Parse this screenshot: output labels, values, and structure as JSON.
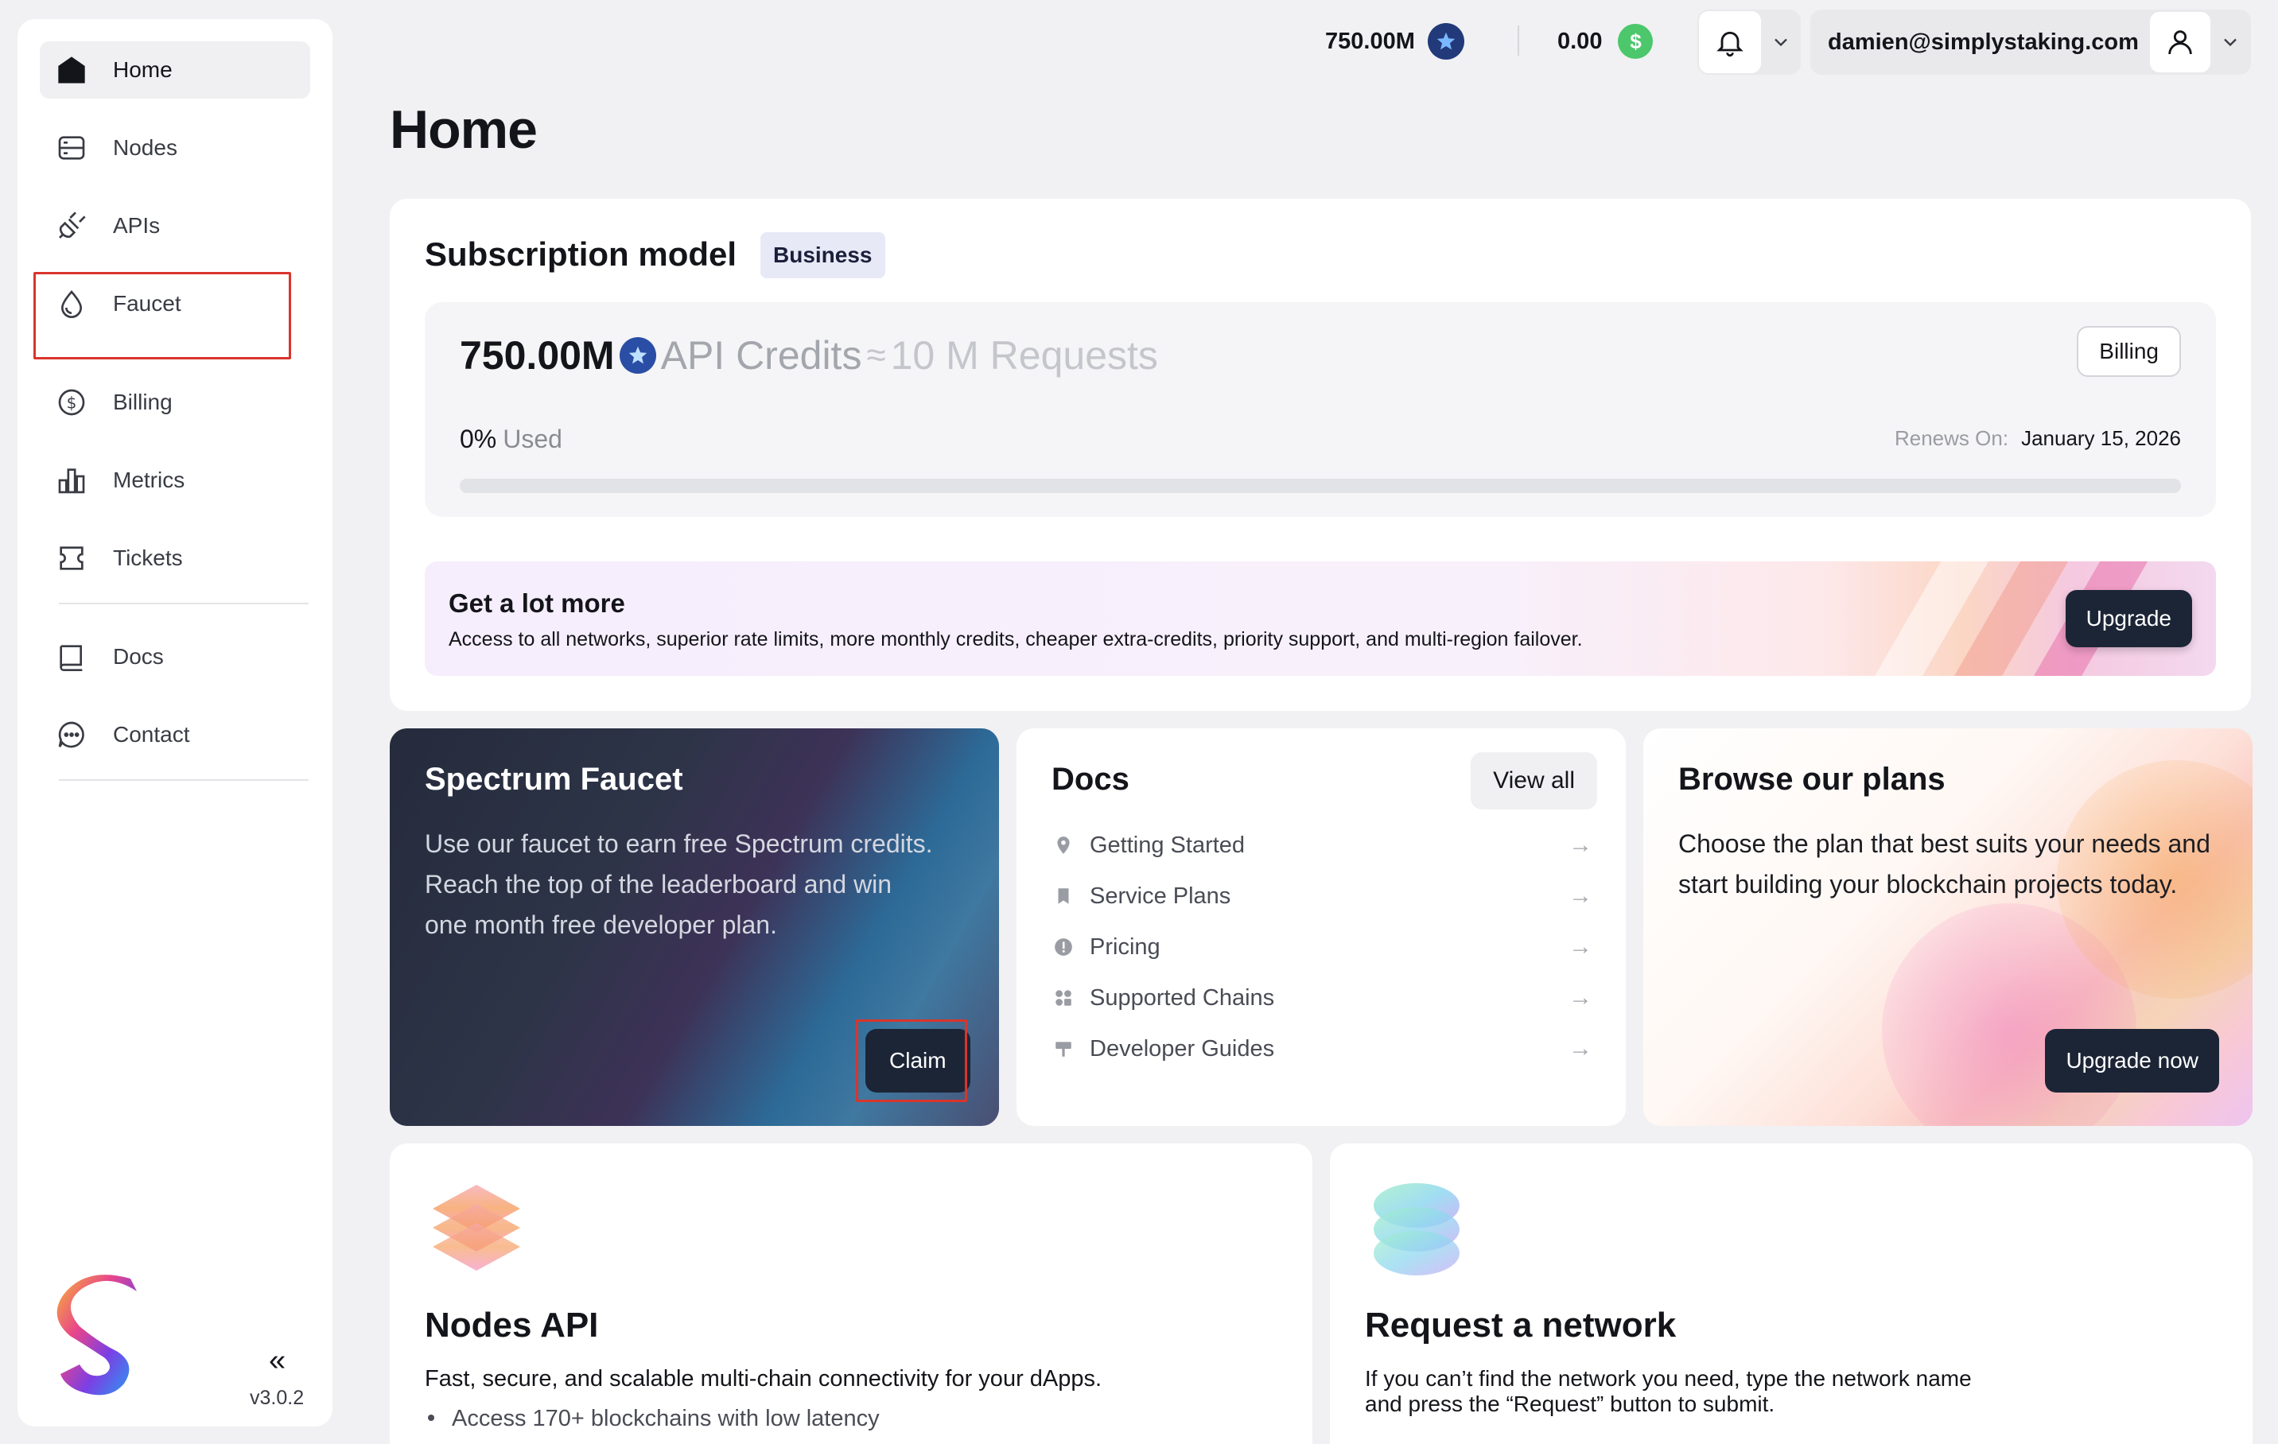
{
  "sidebar": {
    "items": [
      {
        "label": "Home",
        "icon": "home-icon"
      },
      {
        "label": "Nodes",
        "icon": "server-icon"
      },
      {
        "label": "APIs",
        "icon": "plug-icon"
      },
      {
        "label": "Faucet",
        "icon": "droplet-icon"
      },
      {
        "label": "Billing",
        "icon": "dollar-circle-icon"
      },
      {
        "label": "Metrics",
        "icon": "bar-chart-icon"
      },
      {
        "label": "Tickets",
        "icon": "ticket-icon"
      },
      {
        "label": "Docs",
        "icon": "book-icon"
      },
      {
        "label": "Contact",
        "icon": "chat-icon"
      }
    ],
    "active": "Home",
    "collapse_label": "«",
    "version": "v3.0.2"
  },
  "topbar": {
    "credits": "750.00M",
    "balance": "0.00",
    "balance_symbol": "$",
    "user_email": "damien@simplystaking.com"
  },
  "page": {
    "title": "Home"
  },
  "subscription": {
    "title": "Subscription model",
    "plan": "Business",
    "credits_amount": "750.00M",
    "credits_unit": "API Credits",
    "approx_symbol": "≈",
    "requests": "10 M Requests",
    "billing_label": "Billing",
    "used_percent": "0%",
    "used_label": "Used",
    "usage_fraction": 0,
    "renews_label": "Renews On:",
    "renews_date": "January 15, 2026"
  },
  "promo": {
    "title": "Get a lot more",
    "description": "Access to all networks, superior rate limits, more monthly credits, cheaper extra-credits, priority support, and multi-region failover.",
    "button": "Upgrade"
  },
  "faucet": {
    "title": "Spectrum Faucet",
    "description": "Use our faucet to earn free Spectrum credits. Reach the top of the leaderboard and win one month free developer plan.",
    "button": "Claim"
  },
  "docs": {
    "title": "Docs",
    "view_all": "View all",
    "arrow": "→",
    "items": [
      {
        "label": "Getting Started",
        "icon": "pin-icon"
      },
      {
        "label": "Service Plans",
        "icon": "bookmark-icon"
      },
      {
        "label": "Pricing",
        "icon": "info-icon"
      },
      {
        "label": "Supported Chains",
        "icon": "grid-icon"
      },
      {
        "label": "Developer Guides",
        "icon": "signpost-icon"
      }
    ]
  },
  "plans": {
    "title": "Browse our plans",
    "description": "Choose the plan that best suits your needs and start building your blockchain projects today.",
    "button": "Upgrade now"
  },
  "nodes_api": {
    "title": "Nodes API",
    "description": "Fast, secure, and scalable multi-chain connectivity for your dApps.",
    "bullet": "Access 170+ blockchains with low latency"
  },
  "request_network": {
    "title": "Request a network",
    "description": "If you can’t find the network you need, type the network name and press the “Request” button to submit."
  },
  "colors": {
    "primary_button": "#1c2536",
    "highlight_outline": "#d9352b",
    "credit_badge": "#223a7a",
    "balance_badge": "#4cc76b",
    "plan_badge_bg": "#e7e9f7"
  }
}
